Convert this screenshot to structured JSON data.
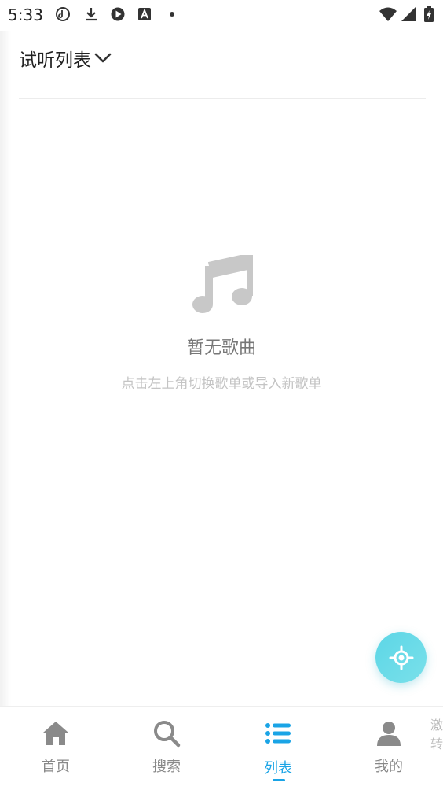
{
  "status_bar": {
    "time": "5:33",
    "icons": [
      "music-app-icon",
      "download-icon",
      "play-app-icon",
      "a-app-icon",
      "dot-icon",
      "wifi-icon",
      "signal-icon",
      "battery-charging-icon"
    ]
  },
  "header": {
    "title": "试听列表",
    "dropdown_icon": "chevron-down-icon"
  },
  "empty_state": {
    "icon": "music-note-icon",
    "title": "暂无歌曲",
    "subtitle": "点击左上角切换歌单或导入新歌单"
  },
  "fab": {
    "icon": "locate-icon"
  },
  "bottom_nav": {
    "items": [
      {
        "label": "首页",
        "icon": "home-icon",
        "active": false
      },
      {
        "label": "搜索",
        "icon": "search-icon",
        "active": false
      },
      {
        "label": "列表",
        "icon": "list-icon",
        "active": true
      },
      {
        "label": "我的",
        "icon": "user-icon",
        "active": false
      }
    ],
    "partial_text": "激转"
  },
  "colors": {
    "accent": "#1aa4e6",
    "fab": "#66d9e8",
    "icon_gray": "#8a8a8a",
    "empty_icon": "#c8c8c8"
  }
}
